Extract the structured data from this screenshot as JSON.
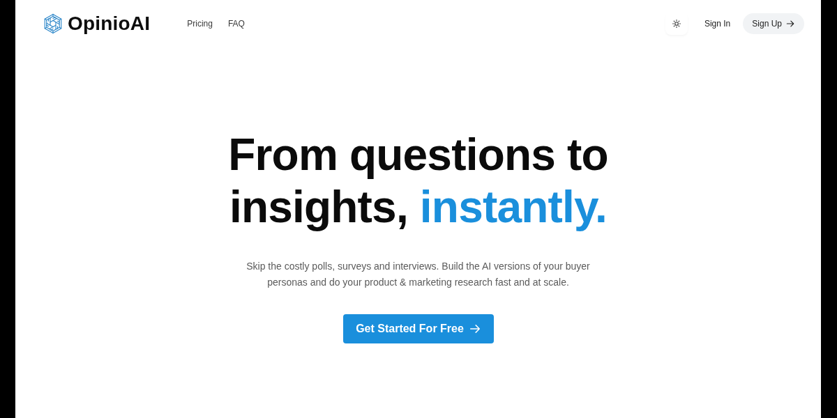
{
  "brand": {
    "name": "OpinioAI"
  },
  "nav": [
    {
      "label": "Pricing"
    },
    {
      "label": "FAQ"
    }
  ],
  "actions": {
    "sign_in": "Sign In",
    "sign_up": "Sign Up"
  },
  "hero": {
    "heading": "From questions to insights,",
    "highlight": "instantly.",
    "subtitle": "Skip the costly polls, surveys and interviews. Build the AI versions of your buyer personas and do your product & marketing research fast and at scale.",
    "cta": "Get Started For Free"
  }
}
